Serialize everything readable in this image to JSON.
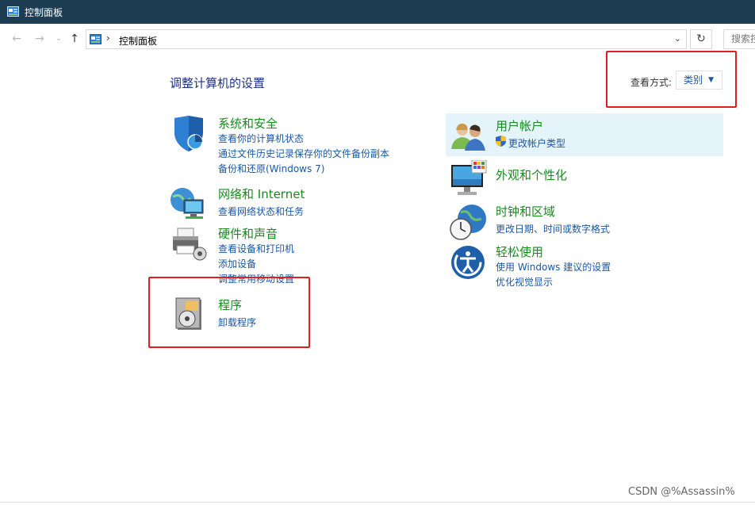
{
  "window": {
    "title": "控制面板"
  },
  "address": {
    "separator": "›",
    "crumb": "控制面板",
    "dropdown": "⌄",
    "refresh": "↻",
    "search_placeholder": "搜索控"
  },
  "nav": {
    "back": "←",
    "forward": "→",
    "recent": "⌄",
    "up": "↑"
  },
  "main": {
    "heading": "调整计算机的设置",
    "view_by_label": "查看方式:",
    "view_by_value": "类别",
    "view_by_caret": "▼"
  },
  "categories": [
    {
      "title": "系统和安全",
      "links": [
        "查看你的计算机状态",
        "通过文件历史记录保存你的文件备份副本",
        "备份和还原(Windows 7)"
      ]
    },
    {
      "title": "网络和 Internet",
      "links": [
        "查看网络状态和任务"
      ]
    },
    {
      "title": "硬件和声音",
      "links": [
        "查看设备和打印机",
        "添加设备",
        "调整常用移动设置"
      ]
    },
    {
      "title": "程序",
      "links": [
        "卸载程序"
      ]
    },
    {
      "title": "用户帐户",
      "links": [
        "更改帐户类型"
      ]
    },
    {
      "title": "外观和个性化",
      "links": []
    },
    {
      "title": "时钟和区域",
      "links": [
        "更改日期、时间或数字格式"
      ]
    },
    {
      "title": "轻松使用",
      "links": [
        "使用 Windows 建议的设置",
        "优化视觉显示"
      ]
    }
  ],
  "watermark": "CSDN @%Assassin%",
  "colors": {
    "titlebar": "#1d3d52",
    "category_title": "#178a1d",
    "link": "#1a57a6",
    "heading": "#1e3287",
    "highlight": "#e5f3fb",
    "annotation_box": "#e02020"
  }
}
